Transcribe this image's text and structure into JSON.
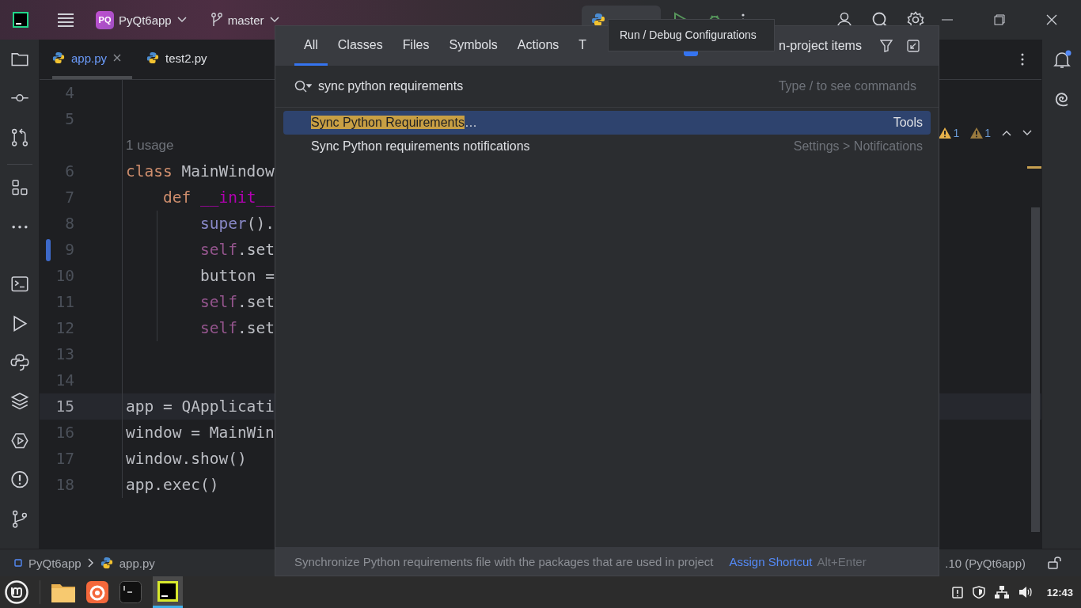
{
  "title_bar": {
    "project_badge": "PQ",
    "project": "PyQt6app",
    "branch": "master"
  },
  "tooltip": "Run / Debug Configurations",
  "editor_tabs": [
    {
      "label": "app.py",
      "selected": true
    },
    {
      "label": "test2.py",
      "selected": false
    }
  ],
  "inspections": [
    "1",
    "1"
  ],
  "editor": {
    "lines": [
      {
        "kind": "code",
        "number": "4",
        "current": false,
        "changed": false
      },
      {
        "kind": "code",
        "number": "5",
        "current": false,
        "changed": false
      },
      {
        "kind": "hint",
        "text": "1 usage"
      },
      {
        "kind": "code",
        "number": "6",
        "current": false,
        "changed": false,
        "tokens": [
          {
            "kind": "keyword",
            "text": "class"
          },
          {
            "kind": "plain",
            "text": "MainWindow"
          }
        ],
        "children": [
          {
            "kind": "code",
            "number": "7",
            "current": false,
            "changed": false,
            "tokens": [
              {
                "kind": "keyword",
                "text": "def"
              },
              {
                "kind": "magic",
                "text": "__init__"
              }
            ],
            "children": [
              {
                "kind": "code",
                "number": "8",
                "current": false,
                "changed": false,
                "tokens": [
                  {
                    "kind": "builtin",
                    "text": "super"
                  },
                  {
                    "kind": "plain",
                    "text": "()."
                  }
                ]
              },
              {
                "kind": "code",
                "number": "9",
                "current": false,
                "changed": true,
                "tokens": [
                  {
                    "kind": "self",
                    "text": "self"
                  },
                  {
                    "kind": "plain",
                    "text": ".set"
                  }
                ]
              },
              {
                "kind": "code",
                "number": "10",
                "current": false,
                "changed": false,
                "tokens": [
                  {
                    "kind": "plain",
                    "text": "button ="
                  }
                ]
              },
              {
                "kind": "code",
                "number": "11",
                "current": false,
                "changed": false,
                "tokens": [
                  {
                    "kind": "self",
                    "text": "self"
                  },
                  {
                    "kind": "plain",
                    "text": ".set"
                  }
                ]
              },
              {
                "kind": "code",
                "number": "12",
                "current": false,
                "changed": false,
                "tokens": [
                  {
                    "kind": "self",
                    "text": "self"
                  },
                  {
                    "kind": "plain",
                    "text": ".set"
                  }
                ]
              }
            ]
          }
        ]
      },
      {
        "kind": "code",
        "number": "13",
        "current": false,
        "changed": false
      },
      {
        "kind": "code",
        "number": "14",
        "current": false,
        "changed": false
      },
      {
        "kind": "code",
        "number": "15",
        "current": true,
        "changed": false,
        "tokens": [
          {
            "kind": "plain",
            "text": "app = QApplicati"
          }
        ]
      },
      {
        "kind": "code",
        "number": "16",
        "current": false,
        "changed": false,
        "tokens": [
          {
            "kind": "plain",
            "text": "window = MainWin"
          }
        ]
      },
      {
        "kind": "code",
        "number": "17",
        "current": false,
        "changed": false,
        "tokens": [
          {
            "kind": "plain",
            "text": "window.show()"
          }
        ]
      },
      {
        "kind": "code",
        "number": "18",
        "current": false,
        "changed": false,
        "tokens": [
          {
            "kind": "plain",
            "text": "app.exec()"
          }
        ]
      }
    ]
  },
  "search_popup": {
    "tabs": [
      {
        "label": "All",
        "selected": true
      },
      {
        "label": "Classes",
        "selected": false
      },
      {
        "label": "Files",
        "selected": false
      },
      {
        "label": "Symbols",
        "selected": false
      },
      {
        "label": "Actions",
        "selected": false
      },
      {
        "label": "T",
        "selected": false
      }
    ],
    "include_checkbox": {
      "label": "n-project items",
      "checked": true
    },
    "query": "sync python requirements",
    "hint": "Type / to see commands",
    "results": [
      {
        "highlight": "Sync Python Requirements",
        "text": "…",
        "location": "Tools",
        "selected": true
      },
      {
        "text": "Sync Python requirements notifications",
        "location": "Settings > Notifications",
        "selected": false
      }
    ],
    "footer": {
      "description": "Synchronize Python requirements file with the packages that are used in project",
      "action": "Assign Shortcut",
      "shortcut": "Alt+Enter"
    }
  },
  "status_bar": {
    "breadcrumbs": [
      "PyQt6app",
      "app.py"
    ],
    "interpreter": ".10 (PyQt6app)"
  },
  "taskbar": {
    "clock": "12:43"
  }
}
